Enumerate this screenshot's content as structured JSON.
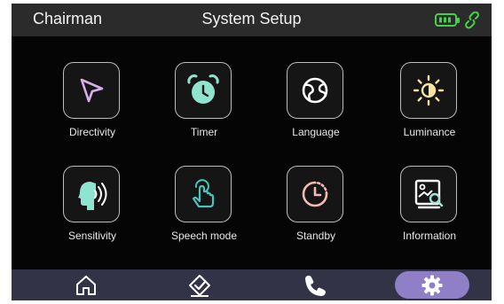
{
  "header": {
    "device_name": "Chairman",
    "title": "System Setup",
    "status_icons": [
      "battery-icon",
      "link-icon"
    ]
  },
  "colors": {
    "background": "#050505",
    "header_bg": "#2b2b2b",
    "nav_bg": "#333347",
    "nav_active": "#8f7fc7",
    "status_green": "#42d447",
    "directivity": "#d6aee9",
    "timer": "#8fe3cf",
    "language": "#ffffff",
    "luminance": "#f6e3a0",
    "sensitivity": "#8fe3cf",
    "speech": "#47c6b7",
    "standby": "#f3b9b3",
    "information": "#a8e0d8"
  },
  "settings": [
    {
      "label": "Directivity",
      "icon": "cursor-arrow-icon"
    },
    {
      "label": "Timer",
      "icon": "alarm-clock-icon"
    },
    {
      "label": "Language",
      "icon": "globe-icon"
    },
    {
      "label": "Luminance",
      "icon": "sun-icon"
    },
    {
      "label": "Sensitivity",
      "icon": "voice-head-icon"
    },
    {
      "label": "Speech mode",
      "icon": "touch-hand-icon"
    },
    {
      "label": "Standby",
      "icon": "clock-icon"
    },
    {
      "label": "Information",
      "icon": "image-search-icon"
    }
  ],
  "navigation": [
    {
      "name": "home",
      "icon": "home-icon",
      "active": false
    },
    {
      "name": "vote",
      "icon": "check-diamond-icon",
      "active": false
    },
    {
      "name": "call",
      "icon": "phone-icon",
      "active": false
    },
    {
      "name": "settings",
      "icon": "gear-icon",
      "active": true
    }
  ]
}
